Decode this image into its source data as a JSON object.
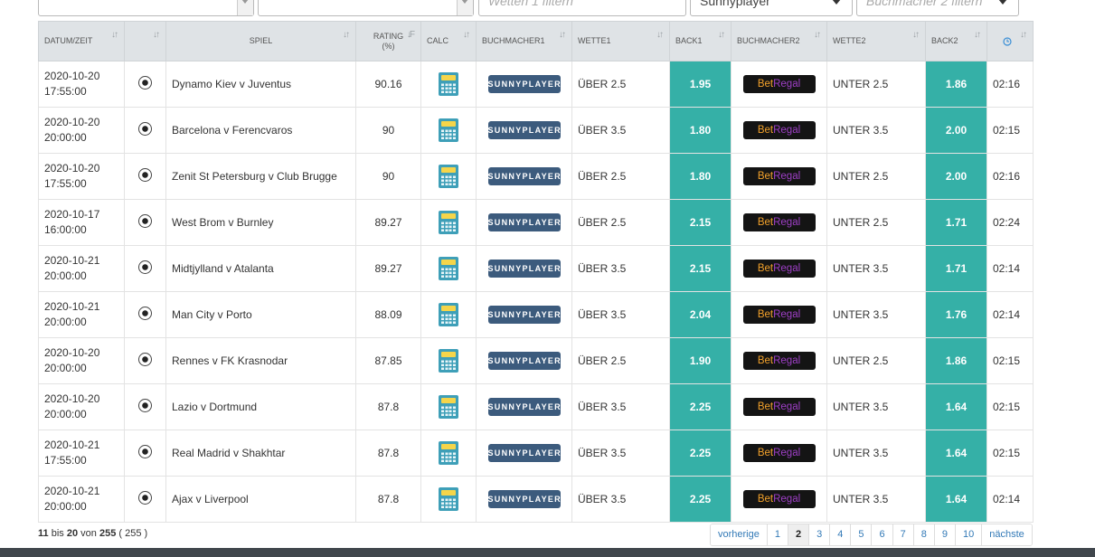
{
  "filters": {
    "box1_value": "",
    "box2_value": "",
    "wetten_placeholder": "Wetten 1 filtern",
    "bookmaker1_selected": "Sunnyplayer",
    "bookmaker2_placeholder": "Buchmacher 2 filtern"
  },
  "columns": {
    "date": "DATUM/ZEIT",
    "sport": "",
    "event": "SPIEL",
    "rating": "RATING (%)",
    "calc": "CALC",
    "bookmaker1": "BUCHMACHER1",
    "bet1": "WETTE1",
    "back1": "BACK1",
    "bookmaker2": "BUCHMACHER2",
    "bet2": "WETTE2",
    "back2": "BACK2",
    "time": ""
  },
  "icons": {
    "sport": "football-icon",
    "calc": "calculator-icon",
    "clock": "clock-icon",
    "sort": "sort-icon"
  },
  "brands": {
    "bookmaker1": "SUNNYPLAYER",
    "bookmaker2_a": "Bet",
    "bookmaker2_b": "Regal"
  },
  "colors": {
    "back_cell": "#35b0a7",
    "header_bg": "#dfe3e6",
    "sunnyplayer_bg": "#3c5b7d",
    "betregal_bg": "#141414"
  },
  "rows": [
    {
      "date": "2020-10-20",
      "time": "17:55:00",
      "event": "Dynamo Kiev v Juventus",
      "rating": "90.16",
      "bet1": "ÜBER 2.5",
      "back1": "1.95",
      "bet2": "UNTER 2.5",
      "back2": "1.86",
      "age": "02:16"
    },
    {
      "date": "2020-10-20",
      "time": "20:00:00",
      "event": "Barcelona v Ferencvaros",
      "rating": "90",
      "bet1": "ÜBER 3.5",
      "back1": "1.80",
      "bet2": "UNTER 3.5",
      "back2": "2.00",
      "age": "02:15"
    },
    {
      "date": "2020-10-20",
      "time": "17:55:00",
      "event": "Zenit St Petersburg v Club Brugge",
      "rating": "90",
      "bet1": "ÜBER 2.5",
      "back1": "1.80",
      "bet2": "UNTER 2.5",
      "back2": "2.00",
      "age": "02:16"
    },
    {
      "date": "2020-10-17",
      "time": "16:00:00",
      "event": "West Brom v Burnley",
      "rating": "89.27",
      "bet1": "ÜBER 2.5",
      "back1": "2.15",
      "bet2": "UNTER 2.5",
      "back2": "1.71",
      "age": "02:24"
    },
    {
      "date": "2020-10-21",
      "time": "20:00:00",
      "event": "Midtjylland v Atalanta",
      "rating": "89.27",
      "bet1": "ÜBER 3.5",
      "back1": "2.15",
      "bet2": "UNTER 3.5",
      "back2": "1.71",
      "age": "02:14"
    },
    {
      "date": "2020-10-21",
      "time": "20:00:00",
      "event": "Man City v Porto",
      "rating": "88.09",
      "bet1": "ÜBER 3.5",
      "back1": "2.04",
      "bet2": "UNTER 3.5",
      "back2": "1.76",
      "age": "02:14"
    },
    {
      "date": "2020-10-20",
      "time": "20:00:00",
      "event": "Rennes v FK Krasnodar",
      "rating": "87.85",
      "bet1": "ÜBER 2.5",
      "back1": "1.90",
      "bet2": "UNTER 2.5",
      "back2": "1.86",
      "age": "02:15"
    },
    {
      "date": "2020-10-20",
      "time": "20:00:00",
      "event": "Lazio v Dortmund",
      "rating": "87.8",
      "bet1": "ÜBER 3.5",
      "back1": "2.25",
      "bet2": "UNTER 3.5",
      "back2": "1.64",
      "age": "02:15"
    },
    {
      "date": "2020-10-21",
      "time": "17:55:00",
      "event": "Real Madrid v Shakhtar",
      "rating": "87.8",
      "bet1": "ÜBER 3.5",
      "back1": "2.25",
      "bet2": "UNTER 3.5",
      "back2": "1.64",
      "age": "02:15"
    },
    {
      "date": "2020-10-21",
      "time": "20:00:00",
      "event": "Ajax v Liverpool",
      "rating": "87.8",
      "bet1": "ÜBER 3.5",
      "back1": "2.25",
      "bet2": "UNTER 3.5",
      "back2": "1.64",
      "age": "02:14"
    }
  ],
  "footer": {
    "from": "11",
    "bis": "bis",
    "to": "20",
    "von": "von",
    "total": "255",
    "total_paren": "( 255 )"
  },
  "pagination": {
    "prev": "vorherige",
    "pages": [
      "1",
      "2",
      "3",
      "4",
      "5",
      "6",
      "7",
      "8",
      "9",
      "10"
    ],
    "active": "2",
    "next": "nächste"
  }
}
